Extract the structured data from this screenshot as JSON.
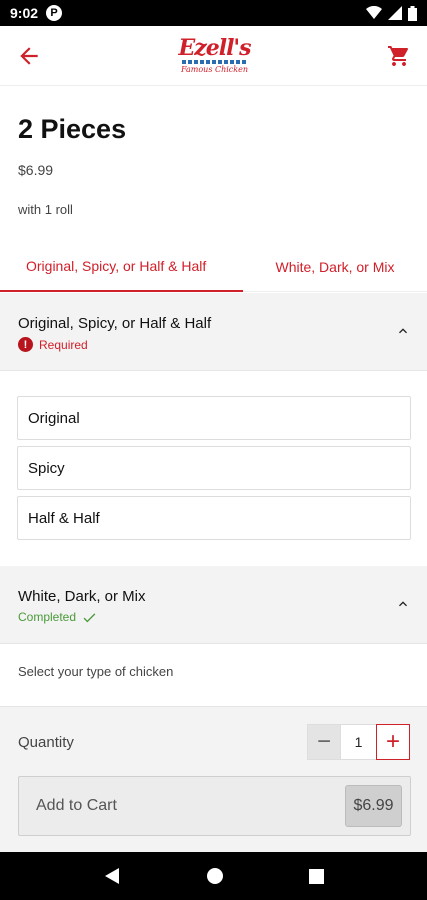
{
  "status_bar": {
    "time": "9:02",
    "notification_glyph": "P",
    "icons": [
      "wifi-icon",
      "signal-icon",
      "battery-icon"
    ]
  },
  "app_bar": {
    "back_icon": "arrow-left-icon",
    "cart_icon": "cart-icon",
    "logo": {
      "brand": "Ezell's",
      "tagline": "Famous Chicken"
    }
  },
  "item": {
    "title": "2 Pieces",
    "price": "$6.99",
    "description": "with 1 roll"
  },
  "tabs": [
    {
      "label": "Original, Spicy, or Half & Half",
      "active": true
    },
    {
      "label": "White, Dark, or Mix",
      "active": false
    }
  ],
  "section1": {
    "title": "Original, Spicy, or Half & Half",
    "status": "Required",
    "status_icon": "!",
    "options": [
      {
        "label": "Original"
      },
      {
        "label": "Spicy"
      },
      {
        "label": "Half & Half"
      }
    ]
  },
  "section2": {
    "title": "White, Dark, or Mix",
    "status": "Completed",
    "hint": "Select your type of chicken"
  },
  "quantity": {
    "label": "Quantity",
    "value": "1",
    "minus": "−",
    "plus": "+"
  },
  "cart_button": {
    "label": "Add to Cart",
    "total": "$6.99"
  },
  "colors": {
    "accent": "#d0202a",
    "success": "#4a9a3a",
    "panel": "#f3f3f3"
  }
}
